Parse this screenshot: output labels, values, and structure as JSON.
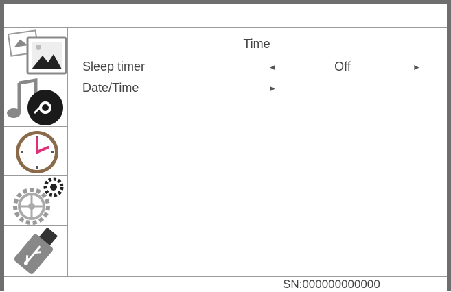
{
  "sidebar": {
    "items": [
      {
        "name": "photo",
        "icon": "photo-icon"
      },
      {
        "name": "music",
        "icon": "music-icon"
      },
      {
        "name": "clock",
        "icon": "clock-icon"
      },
      {
        "name": "settings",
        "icon": "settings-icon"
      },
      {
        "name": "usb",
        "icon": "usb-icon"
      }
    ]
  },
  "menu": {
    "title": "Time",
    "rows": [
      {
        "label": "Sleep timer",
        "value": "Off",
        "left_arrow": "◄",
        "right_arrow": "►"
      },
      {
        "label": "Date/Time",
        "arrow": "►"
      }
    ]
  },
  "status": {
    "serial": "SN:000000000000"
  },
  "colors": {
    "frame": "#6e6e6e",
    "divider": "#9a9a9a",
    "text": "#444444",
    "clock_hand": "#e0307a"
  }
}
